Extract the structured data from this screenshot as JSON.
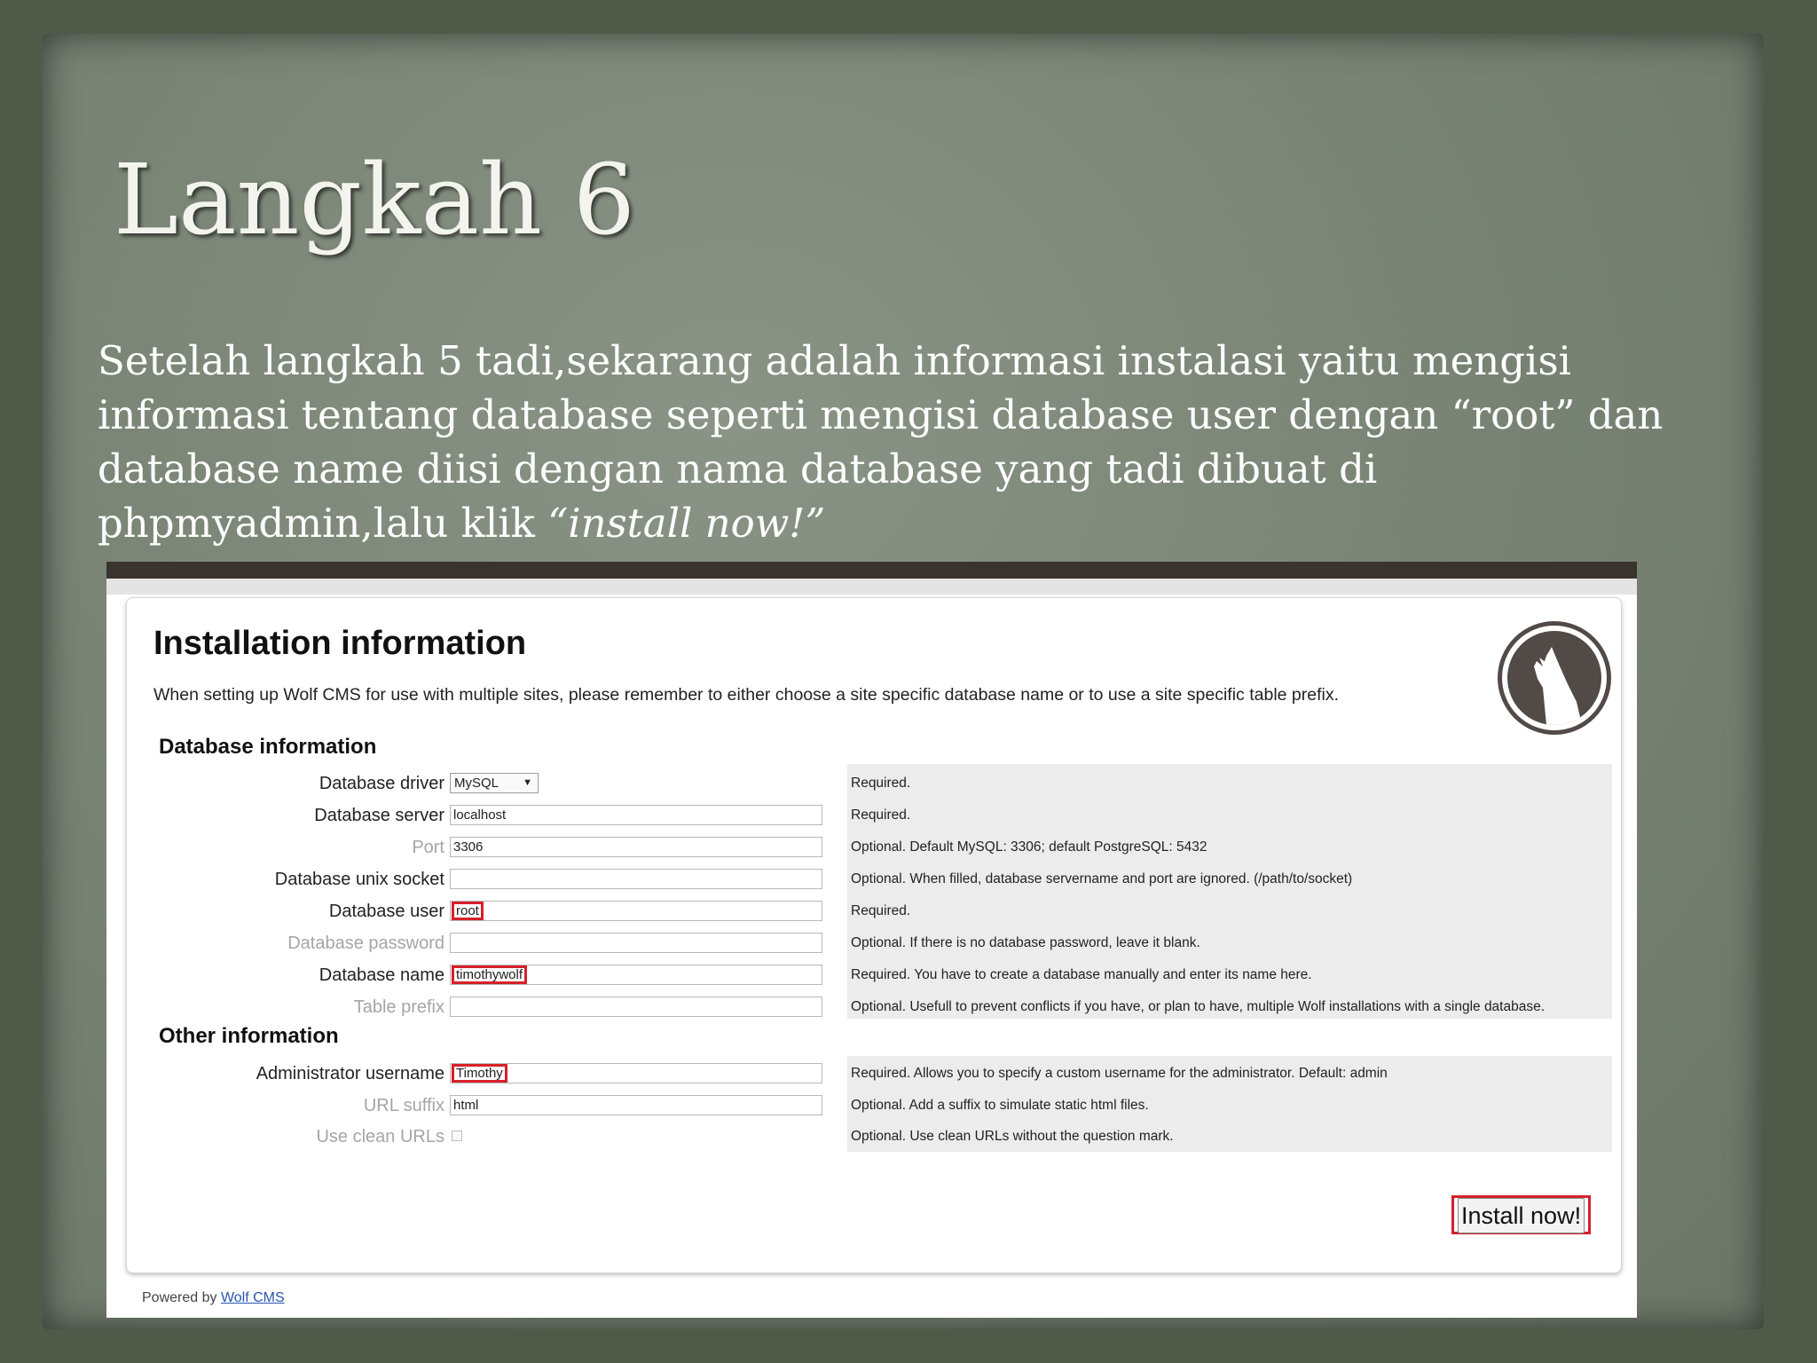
{
  "slide": {
    "title": "Langkah 6",
    "body_text": "Setelah langkah 5 tadi,sekarang adalah informasi instalasi yaitu mengisi informasi tentang database seperti mengisi database user dengan “root” dan database name diisi dengan nama database yang tadi dibuat di phpmyadmin,lalu klik ",
    "body_emphasis": "“install now!”"
  },
  "installer": {
    "title": "Installation information",
    "note": "When setting up Wolf CMS for use with multiple sites, please remember to either choose a site specific database name or to use a site specific table prefix.",
    "logo_icon": "wolf-logo-icon",
    "database_section": {
      "heading": "Database information",
      "rows": [
        {
          "label": "Database driver",
          "value": "MySQL",
          "hint": "Required."
        },
        {
          "label": "Database server",
          "value": "localhost",
          "hint": "Required."
        },
        {
          "label": "Port",
          "value": "3306",
          "hint": "Optional. Default MySQL: 3306; default PostgreSQL: 5432"
        },
        {
          "label": "Database unix socket",
          "value": "",
          "hint": "Optional. When filled, database servername and port are ignored. (/path/to/socket)"
        },
        {
          "label": "Database user",
          "value": "root",
          "hint": "Required."
        },
        {
          "label": "Database password",
          "value": "",
          "hint": "Optional. If there is no database password, leave it blank."
        },
        {
          "label": "Database name",
          "value": "timothywolf",
          "hint": "Required. You have to create a database manually and enter its name here."
        },
        {
          "label": "Table prefix",
          "value": "",
          "hint": "Optional. Usefull to prevent conflicts if you have, or plan to have, multiple Wolf installations with a single database."
        }
      ]
    },
    "other_section": {
      "heading": "Other information",
      "rows": [
        {
          "label": "Administrator username",
          "value": "Timothy",
          "hint": "Required. Allows you to specify a custom username for the administrator. Default: admin"
        },
        {
          "label": "URL suffix",
          "value": "html",
          "hint": "Optional. Add a suffix to simulate static html files."
        },
        {
          "label": "Use clean URLs",
          "value": "",
          "hint": "Optional. Use clean URLs without the question mark."
        }
      ]
    },
    "install_button": "Install now!",
    "footer": {
      "prefix": "Powered by ",
      "link": "Wolf CMS"
    },
    "colors": {
      "highlight": "#d6202a",
      "hint_background": "#ececec",
      "slide_background": "#7a8576"
    }
  }
}
